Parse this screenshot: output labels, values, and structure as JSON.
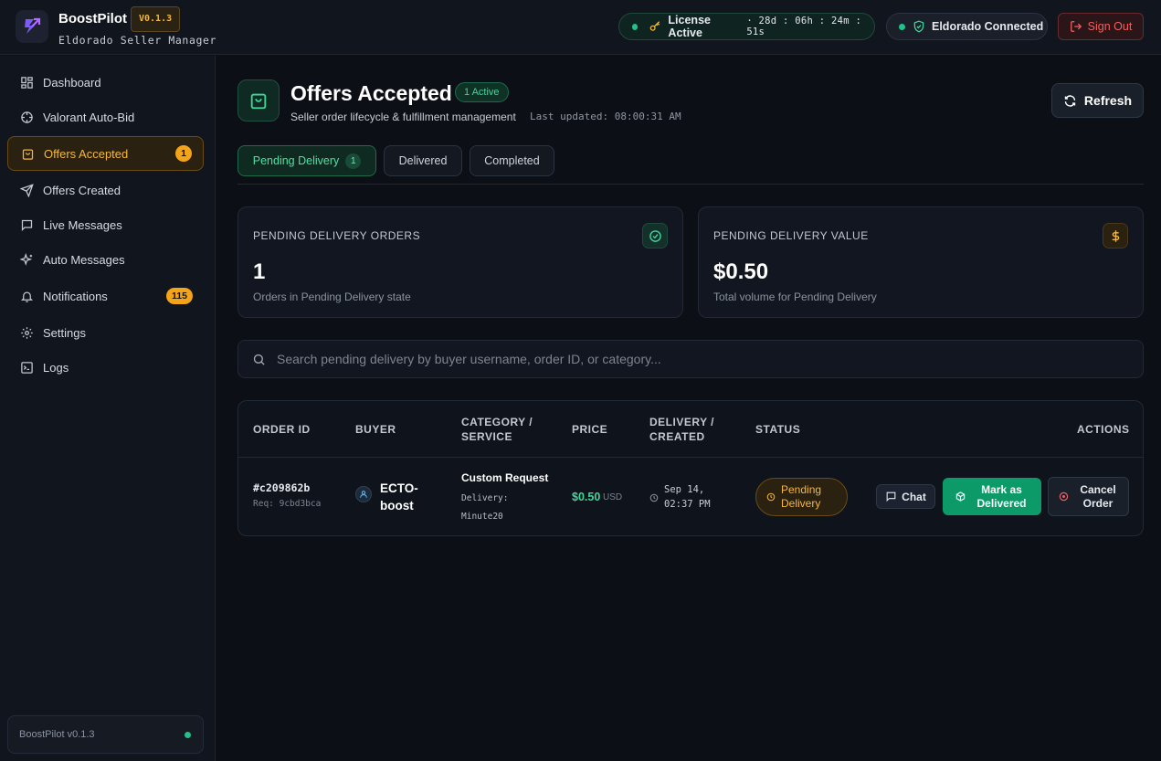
{
  "app": {
    "name": "BoostPilot",
    "version_badge": "V0.1.3",
    "subtitle": "Eldorado Seller Manager"
  },
  "topbar": {
    "license_label": "License Active",
    "license_timer": "· 28d : 06h : 24m : 51s",
    "connection_label": "Eldorado Connected",
    "signout_label": "Sign Out"
  },
  "sidebar": {
    "items": [
      {
        "label": "Dashboard",
        "icon": "grid-icon"
      },
      {
        "label": "Valorant Auto-Bid",
        "icon": "crosshair-icon"
      },
      {
        "label": "Offers Accepted",
        "icon": "shopping-bag-icon",
        "badge": "1",
        "active": true
      },
      {
        "label": "Offers Created",
        "icon": "send-icon"
      },
      {
        "label": "Live Messages",
        "icon": "message-icon"
      },
      {
        "label": "Auto Messages",
        "icon": "sparkles-icon"
      },
      {
        "label": "Notifications",
        "icon": "bell-icon",
        "badge": "115"
      },
      {
        "label": "Settings",
        "icon": "gear-icon"
      },
      {
        "label": "Logs",
        "icon": "terminal-icon"
      }
    ],
    "footer_version": "BoostPilot v0.1.3"
  },
  "header": {
    "title": "Offers Accepted",
    "active_badge": "1 Active",
    "subtitle": "Seller order lifecycle & fulfillment management",
    "last_updated": "Last updated: 08:00:31 AM",
    "refresh_label": "Refresh"
  },
  "tabs": [
    {
      "label": "Pending Delivery",
      "count": "1",
      "active": true
    },
    {
      "label": "Delivered"
    },
    {
      "label": "Completed"
    }
  ],
  "stats": [
    {
      "label": "PENDING DELIVERY ORDERS",
      "value": "1",
      "desc": "Orders in Pending Delivery state",
      "icon": "check-circle-icon"
    },
    {
      "label": "PENDING DELIVERY VALUE",
      "value": "$0.50",
      "desc": "Total volume for Pending Delivery",
      "icon": "dollar-icon"
    }
  ],
  "search": {
    "placeholder": "Search pending delivery by buyer username, order ID, or category..."
  },
  "table": {
    "columns": [
      "ORDER ID",
      "BUYER",
      "CATEGORY / SERVICE",
      "PRICE",
      "DELIVERY / CREATED",
      "STATUS",
      "ACTIONS"
    ],
    "rows": [
      {
        "order_id": "#c209862b",
        "req_id": "Req: 9cbd3bca",
        "buyer": "ECTO-boost",
        "category": "Custom Request",
        "delivery": "Delivery: Minute20",
        "price": "$0.50",
        "currency": "USD",
        "created": "Sep 14, 02:37 PM",
        "status": "Pending Delivery",
        "actions": {
          "chat": "Chat",
          "deliver": "Mark as Delivered",
          "cancel": "Cancel Order"
        }
      }
    ]
  },
  "colors": {
    "accent_amber": "#f3b73f",
    "accent_green": "#3fd69a",
    "danger": "#f06060",
    "background": "#0c0f15"
  }
}
